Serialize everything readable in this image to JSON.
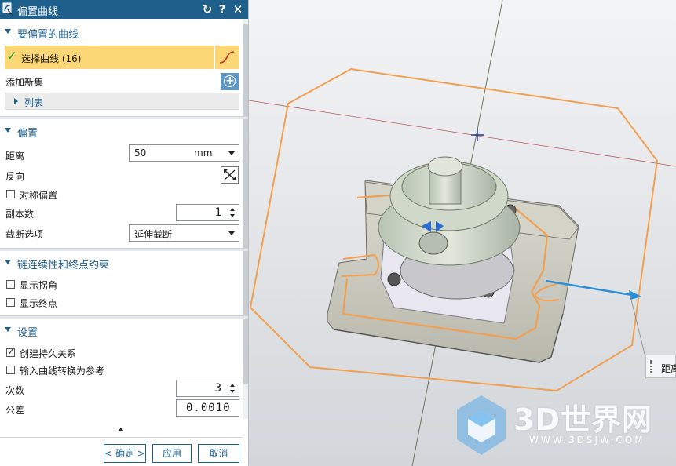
{
  "dialog": {
    "title": "偏置曲线",
    "buttons": {
      "reset": "↻",
      "help": "?",
      "close": "✕"
    }
  },
  "sections": {
    "curves": {
      "header": "要偏置的曲线",
      "select_curve": "选择曲线 (16)",
      "add_new_set": "添加新集",
      "list": "列表"
    },
    "offset": {
      "header": "偏置",
      "distance_label": "距离",
      "distance_value": "50",
      "distance_unit": "mm",
      "reverse_label": "反向",
      "symmetric_label": "对称偏置",
      "symmetric_checked": false,
      "copies_label": "副本数",
      "copies_value": "1",
      "trim_label": "截断选项",
      "trim_value": "延伸截断"
    },
    "chain": {
      "header": "链连续性和终点约束",
      "show_corners": "显示拐角",
      "show_corners_checked": false,
      "show_endpoints": "显示终点",
      "show_endpoints_checked": false
    },
    "settings": {
      "header": "设置",
      "associative": "创建持久关系",
      "associative_checked": true,
      "convert_ref": "输入曲线转换为参考",
      "convert_ref_checked": false,
      "degree_label": "次数",
      "degree_value": "3",
      "tolerance_label": "公差",
      "tolerance_value": "0.0010"
    }
  },
  "footer": {
    "ok": "< 确定 >",
    "apply": "应用",
    "cancel": "取消"
  },
  "viewport": {
    "tooltip": "距离"
  },
  "watermark": {
    "brand": "3D世界网",
    "url": "WWW.3DSJW.COM"
  },
  "colors": {
    "title_bar": "#1f5f8c",
    "selection_highlight": "#fcd776",
    "offset_curve": "#f0a050",
    "direction_arrow": "#2a8fd8"
  }
}
